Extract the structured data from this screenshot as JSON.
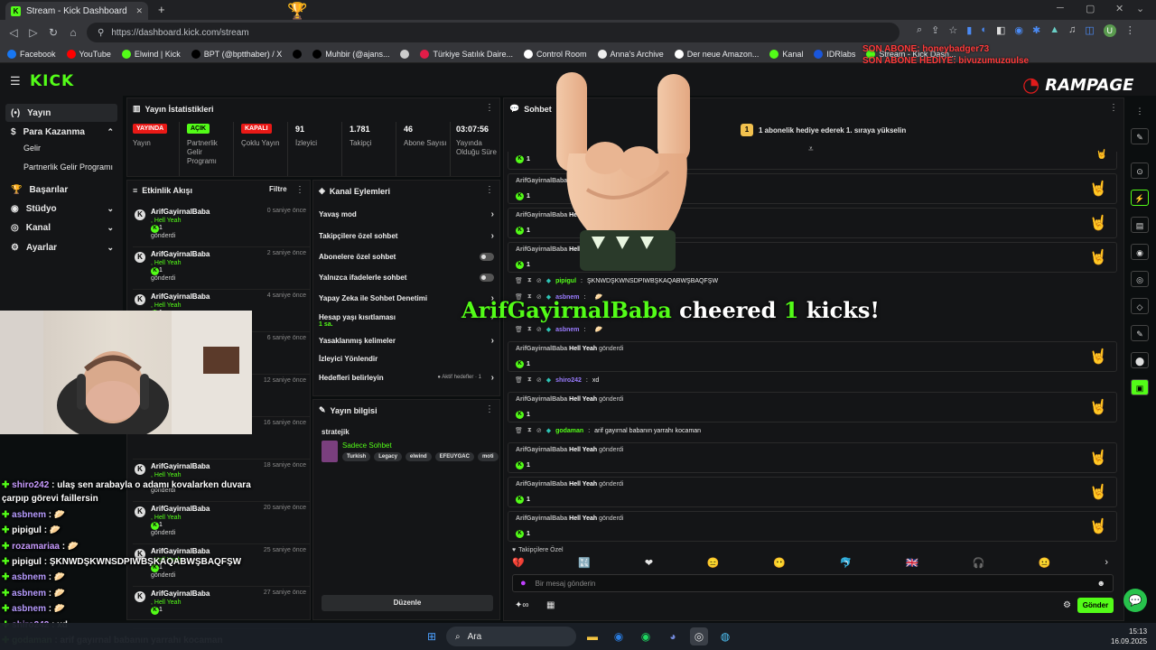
{
  "browser": {
    "tab_title": "Stream - Kick Dashboard",
    "tab_close": "✕",
    "new_tab": "+",
    "url": "https://dashboard.kick.com/stream",
    "bookmarks": [
      "Facebook",
      "YouTube",
      "Elwind | Kick",
      "BPT (@bptthaber) / X",
      "",
      "Muhbir (@ajans...",
      "",
      "Türkiye Satılık Daire...",
      "Control Room",
      "Anna's Archive",
      "Der neue Amazon...",
      "Kanal",
      "IDRlabs",
      "Stream - Kick Dash..."
    ],
    "profile_initial": "U"
  },
  "overlay_top": {
    "line1": "SON ABONE: honeybadger73",
    "line2": "SON ABONE HEDİYE: biyuzumuzgulse"
  },
  "brand": {
    "kick": "KICK",
    "rampage": "RAMPAGE"
  },
  "nav": {
    "items": [
      {
        "label": "Yayın",
        "icon": "(•)"
      },
      {
        "label": "Para Kazanma",
        "icon": "$"
      },
      {
        "label": "Başarılar",
        "icon": "🏆"
      },
      {
        "label": "Stüdyo",
        "icon": "◉"
      },
      {
        "label": "Kanal",
        "icon": "◎"
      },
      {
        "label": "Ayarlar",
        "icon": "⚙"
      }
    ],
    "sub": [
      "Gelir",
      "Partnerlik Gelir Programı"
    ]
  },
  "stats": {
    "title": "Yayın İstatistikleri",
    "items": [
      {
        "badge": "YAYINDA",
        "badge_color": "#e91916",
        "label": "Yayın"
      },
      {
        "badge": "AÇIK",
        "badge_color": "#53fc18",
        "label": "Partnerlik Gelir Programı"
      },
      {
        "badge": "KAPALI",
        "badge_color": "#e91916",
        "label": "Çoklu Yayın"
      },
      {
        "value": "91",
        "label": "İzleyici"
      },
      {
        "value": "1.781",
        "label": "Takipçi"
      },
      {
        "value": "46",
        "label": "Abone Sayısı"
      },
      {
        "value": "03:07:56",
        "label": "Yayında Olduğu Süre"
      }
    ]
  },
  "activity": {
    "title": "Etkinlik Akışı",
    "filter": "Filtre",
    "events": [
      {
        "user": "ArifGayirnalBaba",
        "msg": ", Hell Yeah",
        "count": "1",
        "sent": "gönderdi",
        "time": "0 saniye önce"
      },
      {
        "user": "ArifGayirnalBaba",
        "msg": ", Hell Yeah",
        "count": "1",
        "sent": "gönderdi",
        "time": "2 saniye önce"
      },
      {
        "user": "ArifGayirnalBaba",
        "msg": ", Hell Yeah",
        "count": "1",
        "sent": "gönderdi",
        "time": "4 saniye önce"
      },
      {
        "user": "",
        "msg": "",
        "count": "",
        "sent": "",
        "time": "6 saniye önce"
      },
      {
        "user": "",
        "msg": "",
        "count": "",
        "sent": "",
        "time": "12 saniye önce"
      },
      {
        "user": "",
        "msg": "",
        "count": "",
        "sent": "",
        "time": "16 saniye önce"
      },
      {
        "user": "ArifGayirnalBaba",
        "msg": ", Hell Yeah",
        "count": "",
        "sent": "gönderdi",
        "time": "18 saniye önce"
      },
      {
        "user": "ArifGayirnalBaba",
        "msg": ", Hell Yeah",
        "count": "1",
        "sent": "gönderdi",
        "time": "20 saniye önce"
      },
      {
        "user": "ArifGayirnalBaba",
        "msg": ", Hell Yeah",
        "count": "1",
        "sent": "gönderdi",
        "time": "25 saniye önce"
      },
      {
        "user": "ArifGayirnalBaba",
        "msg": ", Hell Yeah",
        "count": "1",
        "sent": "",
        "time": "27 saniye önce"
      }
    ]
  },
  "channel_actions": {
    "title": "Kanal Eylemleri",
    "items": [
      {
        "label": "Yavaş mod",
        "ctl": "›"
      },
      {
        "label": "Takipçilere özel sohbet",
        "ctl": "›"
      },
      {
        "label": "Abonelere özel sohbet",
        "ctl": "toggle"
      },
      {
        "label": "Yalnızca ifadelerle sohbet",
        "ctl": "toggle"
      },
      {
        "label": "Yapay Zeka ile Sohbet Denetimi",
        "ctl": "›"
      },
      {
        "label": "Hesap yaşı kısıtlaması",
        "ctl": "›",
        "sub": "1 sa."
      },
      {
        "label": "Yasaklanmış kelimeler",
        "ctl": "›"
      },
      {
        "label": "İzleyici Yönlendir",
        "ctl": ""
      },
      {
        "label": "Hedefleri belirleyin",
        "ctl": "›",
        "extra": "● Aktif hedefler · 1"
      }
    ],
    "edit": "Düzenle"
  },
  "stream_info": {
    "title": "Yayın bilgisi",
    "name": "stratejik",
    "category": "Sadece Sohbet",
    "tags": [
      "Turkish",
      "Legacy",
      "elwind",
      "EFEUYGAC",
      "moti"
    ]
  },
  "chat": {
    "title": "Sohbet",
    "pinned": "1 abonelik hediye ederek 1. sıraya yükselin",
    "pinned_rank": "1",
    "cheer_user": "ArifGayirnalBaba",
    "cheer_text": "cheered",
    "cheer_amount": "1",
    "cheer_unit": "kicks!",
    "messages": [
      {
        "type": "kick",
        "user": "",
        "msg": "",
        "sent": "",
        "count": "1"
      },
      {
        "type": "kick",
        "user": "ArifGayirnalBaba",
        "msg": "Hell",
        "sent": "",
        "count": "1"
      },
      {
        "type": "kick",
        "user": "ArifGayirnalBaba",
        "msg": "Hell",
        "sent": "",
        "count": "1"
      },
      {
        "type": "kick",
        "user": "ArifGayirnalBaba",
        "msg": "Hell",
        "sent": "",
        "count": "1"
      },
      {
        "type": "line",
        "user": "pipigul",
        "text": "ŞKNWDŞKWNSDPIWBŞKAQABWŞBAQFŞW",
        "color": "#53fc18"
      },
      {
        "type": "line",
        "user": "asbnem",
        "text": "",
        "color": "#9a7cff"
      },
      {
        "type": "line",
        "user": "asbnem",
        "text": "",
        "color": "#9a7cff"
      },
      {
        "type": "kick",
        "user": "ArifGayirnalBaba",
        "msg": "Hell Yeah",
        "sent": "gönderdi",
        "count": "1"
      },
      {
        "type": "line",
        "user": "shiro242",
        "text": "xd",
        "color": "#9a7cff"
      },
      {
        "type": "kick",
        "user": "ArifGayirnalBaba",
        "msg": "Hell Yeah",
        "sent": "gönderdi",
        "count": "1"
      },
      {
        "type": "line",
        "user": "godaman",
        "text": "arif gayırnal babanın yarrahı kocaman",
        "color": "#53fc18"
      },
      {
        "type": "kick",
        "user": "ArifGayirnalBaba",
        "msg": "Hell Yeah",
        "sent": "gönderdi",
        "count": "1"
      },
      {
        "type": "kick",
        "user": "ArifGayirnalBaba",
        "msg": "Hell Yeah",
        "sent": "gönderdi",
        "count": "1"
      },
      {
        "type": "kick",
        "user": "ArifGayirnalBaba",
        "msg": "Hell Yeah",
        "sent": "gönderdi",
        "count": "1"
      }
    ],
    "followers_only": "Takipçilere Özel",
    "input_placeholder": "Bir mesaj gönderin",
    "send": "Gönder"
  },
  "overlay_chat": [
    {
      "user": "shiro242",
      "text": ": ulaş sen arabayla o adamı kovalarken duvara",
      "color": "#c89bff"
    },
    {
      "user": "",
      "text": "çarpıp görevi faillersin",
      "color": "#fff"
    },
    {
      "user": "asbnem",
      "text": ":",
      "color": "#b79cff"
    },
    {
      "user": "pipigul",
      "text": ":",
      "color": "#fff"
    },
    {
      "user": "rozamariaa",
      "text": ":",
      "color": "#c89bff"
    },
    {
      "user": "pipigul",
      "text": ": ŞKNWDŞKWNSDPIWBŞKAQABWŞBAQFŞW",
      "color": "#fff"
    },
    {
      "user": "asbnem",
      "text": ":",
      "color": "#b79cff"
    },
    {
      "user": "asbnem",
      "text": ":",
      "color": "#b79cff"
    },
    {
      "user": "asbnem",
      "text": ":",
      "color": "#b79cff"
    },
    {
      "user": "shiro242",
      "text": ": xd",
      "color": "#c89bff"
    },
    {
      "user": "godaman",
      "text": ": arif gayırnal babanın yarrahı kocaman",
      "color": "#9ef08a"
    }
  ],
  "taskbar": {
    "search": "Ara",
    "time": "15:13",
    "date": "16.09.2025"
  }
}
